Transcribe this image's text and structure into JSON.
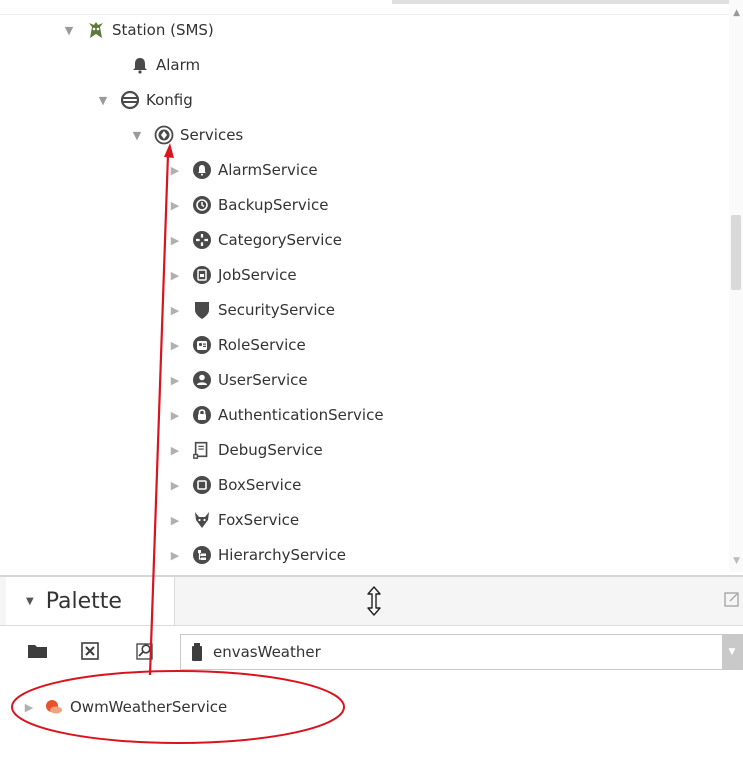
{
  "tree": {
    "items": [
      {
        "label": "Station (SMS)",
        "icon": "station-icon",
        "expanded": true
      },
      {
        "label": "Alarm",
        "icon": "bell-icon"
      },
      {
        "label": "Konfig",
        "icon": "database-icon",
        "expanded": true
      },
      {
        "label": "Services",
        "icon": "services-icon",
        "expanded": true
      },
      {
        "label": "AlarmService",
        "icon": "alarm-service-icon"
      },
      {
        "label": "BackupService",
        "icon": "backup-service-icon"
      },
      {
        "label": "CategoryService",
        "icon": "category-service-icon"
      },
      {
        "label": "JobService",
        "icon": "job-service-icon"
      },
      {
        "label": "SecurityService",
        "icon": "shield-icon"
      },
      {
        "label": "RoleService",
        "icon": "role-service-icon"
      },
      {
        "label": "UserService",
        "icon": "user-service-icon"
      },
      {
        "label": "AuthenticationService",
        "icon": "lock-service-icon"
      },
      {
        "label": "DebugService",
        "icon": "debug-service-icon"
      },
      {
        "label": "BoxService",
        "icon": "box-service-icon"
      },
      {
        "label": "FoxService",
        "icon": "fox-icon"
      },
      {
        "label": "HierarchyService",
        "icon": "hierarchy-service-icon"
      }
    ]
  },
  "palette": {
    "title": "Palette",
    "module_value": "envasWeather",
    "items": [
      {
        "label": "OwmWeatherService",
        "icon": "weather-service-icon"
      }
    ]
  },
  "colors": {
    "annotation": "#d9141e",
    "icon_dark": "#4a4a4a",
    "weather_icon": "#e8522a"
  }
}
